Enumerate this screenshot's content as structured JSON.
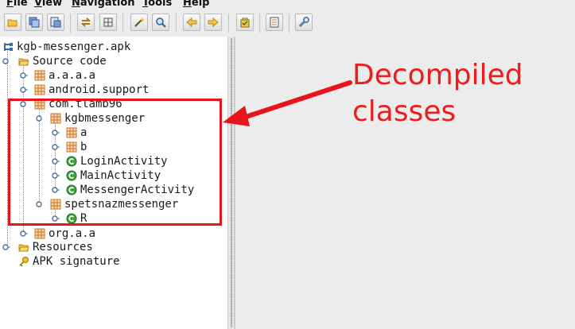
{
  "menubar": {
    "items": [
      {
        "mnemonic": "F",
        "rest": "ile"
      },
      {
        "mnemonic": "V",
        "rest": "iew"
      },
      {
        "mnemonic": "N",
        "rest": "avigation"
      },
      {
        "mnemonic": "T",
        "rest": "ools"
      },
      {
        "mnemonic": "H",
        "rest": "elp"
      }
    ]
  },
  "toolbar": {
    "buttons": [
      "open-file-icon",
      "save-all-icon",
      "export-icon",
      "sync-icon",
      "flatten-packages-icon",
      "wand-icon",
      "search-icon",
      "back-icon",
      "forward-icon",
      "deobfuscation-icon",
      "log-icon",
      "preferences-icon"
    ]
  },
  "tree": {
    "root": "kgb-messenger.apk",
    "source_code": "Source code",
    "pkg_aaaa": "a.a.a.a",
    "pkg_android_support": "android.support",
    "pkg_com_tlamb96": "com.tlamb96",
    "pkg_kgbmessenger": "kgbmessenger",
    "pkg_a": "a",
    "pkg_b": "b",
    "cls_login": "LoginActivity",
    "cls_main": "MainActivity",
    "cls_messenger": "MessengerActivity",
    "pkg_spetsnaz": "spetsnazmessenger",
    "cls_r": "R",
    "pkg_org_aa": "org.a.a",
    "resources": "Resources",
    "apk_signature": "APK signature"
  },
  "annotation": {
    "line1": "Decompiled",
    "line2": "classes"
  },
  "colors": {
    "annotation_red": "#ee1c1c",
    "package_orange": "#c8762a",
    "class_green": "#3aa53a",
    "folder_yellow": "#f3c441"
  }
}
